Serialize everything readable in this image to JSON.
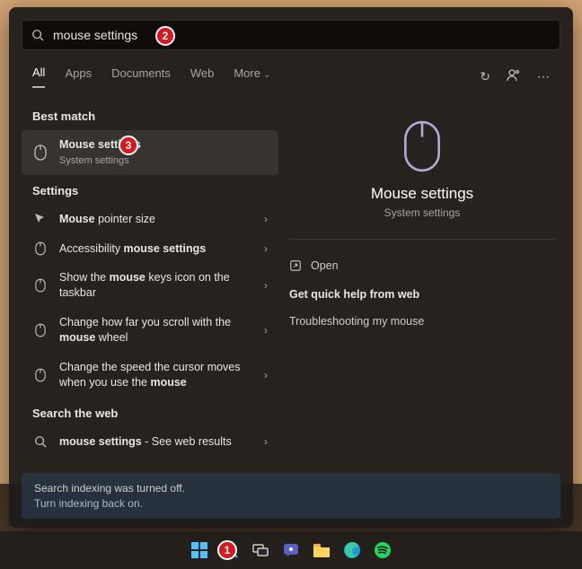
{
  "search": {
    "value": "mouse settings"
  },
  "tabs": {
    "t0": "All",
    "t1": "Apps",
    "t2": "Documents",
    "t3": "Web",
    "t4": "More"
  },
  "sections": {
    "best": "Best match",
    "settings": "Settings",
    "web": "Search the web"
  },
  "best": {
    "title_html": "<b>Mouse settings</b>",
    "sub": "System settings"
  },
  "settings_items": {
    "s0": "<b>Mouse</b> pointer size",
    "s1": "Accessibility <b>mouse settings</b>",
    "s2": "Show the <b>mouse</b> keys icon on the taskbar",
    "s3": "Change how far you scroll with the <b>mouse</b> wheel",
    "s4": "Change the speed the cursor moves when you use the <b>mouse</b>"
  },
  "web_item": "<b>mouse settings</b> - See web results",
  "banner": {
    "l1": "Search indexing was turned off.",
    "l2": "Turn indexing back on."
  },
  "detail": {
    "title": "Mouse settings",
    "sub": "System settings",
    "open": "Open",
    "help_hd": "Get quick help from web",
    "help0": "Troubleshooting my mouse"
  },
  "annotations": {
    "a1": "1",
    "a2": "2",
    "a3": "3"
  }
}
